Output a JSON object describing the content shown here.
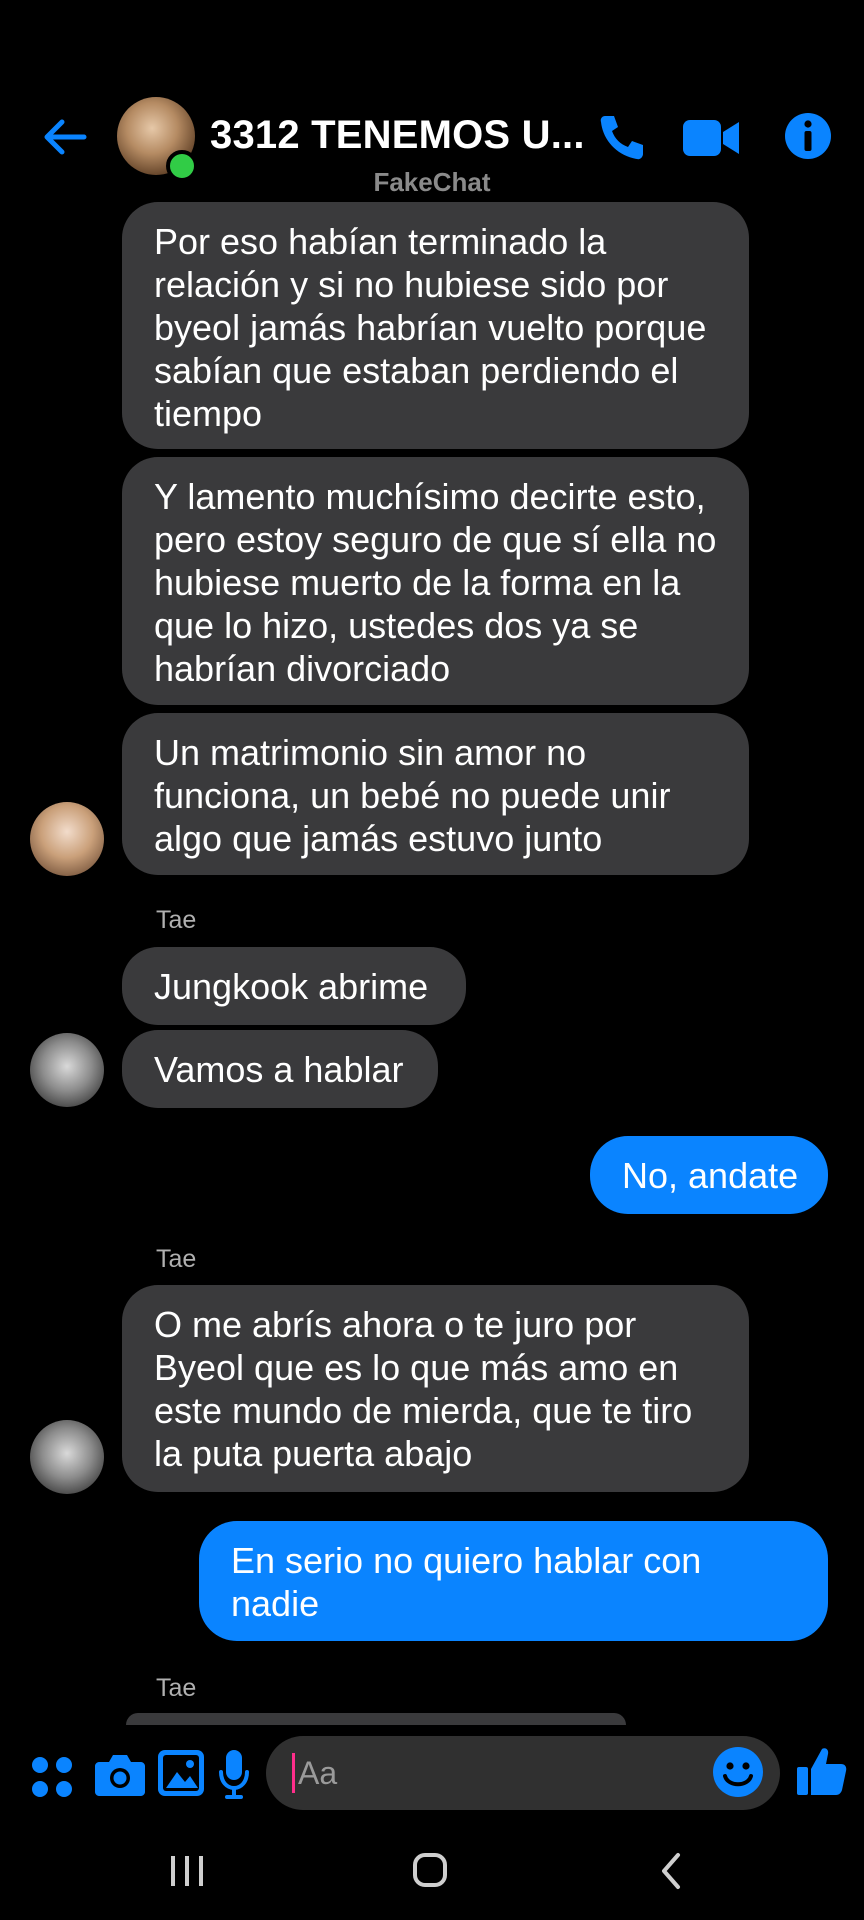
{
  "header": {
    "title": "3312 TENEMOS U...",
    "watermark": "FakeChat",
    "accent_color": "#0a84ff",
    "online_color": "#31cc46",
    "icons": [
      "back-arrow-icon",
      "phone-icon",
      "video-camera-icon",
      "info-icon"
    ]
  },
  "messages": [
    {
      "text": "Por eso habían terminado la relación y si no hubiese sido por byeol jamás habrían vuelto porque sabían que estaban perdiendo el tiempo"
    },
    {
      "text": "Y lamento muchísimo decirte esto, pero estoy seguro de que sí ella no hubiese muerto de la forma en la que lo hizo, ustedes dos ya se habrían divorciado"
    },
    {
      "text": "Un matrimonio sin amor no funciona, un bebé no puede unir algo que jamás estuvo junto"
    },
    {
      "sender": "Tae"
    },
    {
      "text": "Jungkook abrime"
    },
    {
      "text": "Vamos a hablar"
    },
    {
      "text": "No, andate"
    },
    {
      "sender": "Tae"
    },
    {
      "text": "O me abrís ahora o te juro por Byeol que es lo que más amo en este mundo de mierda, que te tiro la puta puerta abajo"
    },
    {
      "text": "En serio no quiero hablar con nadie"
    },
    {
      "sender": "Tae"
    }
  ],
  "composer": {
    "placeholder": "Aa",
    "icons": [
      "apps-icon",
      "camera-icon",
      "gallery-icon",
      "mic-icon",
      "emoji-icon",
      "like-icon"
    ]
  },
  "navbar": {
    "icons": [
      "recents-icon",
      "home-icon",
      "back-icon"
    ]
  }
}
